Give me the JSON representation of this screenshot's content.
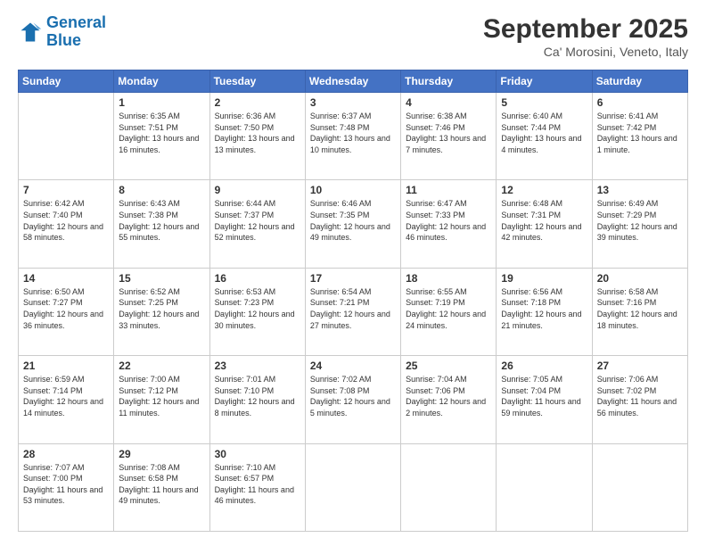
{
  "header": {
    "logo_line1": "General",
    "logo_line2": "Blue",
    "month": "September 2025",
    "location": "Ca' Morosini, Veneto, Italy"
  },
  "days_of_week": [
    "Sunday",
    "Monday",
    "Tuesday",
    "Wednesday",
    "Thursday",
    "Friday",
    "Saturday"
  ],
  "weeks": [
    [
      {
        "day": "",
        "sunrise": "",
        "sunset": "",
        "daylight": ""
      },
      {
        "day": "1",
        "sunrise": "Sunrise: 6:35 AM",
        "sunset": "Sunset: 7:51 PM",
        "daylight": "Daylight: 13 hours and 16 minutes."
      },
      {
        "day": "2",
        "sunrise": "Sunrise: 6:36 AM",
        "sunset": "Sunset: 7:50 PM",
        "daylight": "Daylight: 13 hours and 13 minutes."
      },
      {
        "day": "3",
        "sunrise": "Sunrise: 6:37 AM",
        "sunset": "Sunset: 7:48 PM",
        "daylight": "Daylight: 13 hours and 10 minutes."
      },
      {
        "day": "4",
        "sunrise": "Sunrise: 6:38 AM",
        "sunset": "Sunset: 7:46 PM",
        "daylight": "Daylight: 13 hours and 7 minutes."
      },
      {
        "day": "5",
        "sunrise": "Sunrise: 6:40 AM",
        "sunset": "Sunset: 7:44 PM",
        "daylight": "Daylight: 13 hours and 4 minutes."
      },
      {
        "day": "6",
        "sunrise": "Sunrise: 6:41 AM",
        "sunset": "Sunset: 7:42 PM",
        "daylight": "Daylight: 13 hours and 1 minute."
      }
    ],
    [
      {
        "day": "7",
        "sunrise": "Sunrise: 6:42 AM",
        "sunset": "Sunset: 7:40 PM",
        "daylight": "Daylight: 12 hours and 58 minutes."
      },
      {
        "day": "8",
        "sunrise": "Sunrise: 6:43 AM",
        "sunset": "Sunset: 7:38 PM",
        "daylight": "Daylight: 12 hours and 55 minutes."
      },
      {
        "day": "9",
        "sunrise": "Sunrise: 6:44 AM",
        "sunset": "Sunset: 7:37 PM",
        "daylight": "Daylight: 12 hours and 52 minutes."
      },
      {
        "day": "10",
        "sunrise": "Sunrise: 6:46 AM",
        "sunset": "Sunset: 7:35 PM",
        "daylight": "Daylight: 12 hours and 49 minutes."
      },
      {
        "day": "11",
        "sunrise": "Sunrise: 6:47 AM",
        "sunset": "Sunset: 7:33 PM",
        "daylight": "Daylight: 12 hours and 46 minutes."
      },
      {
        "day": "12",
        "sunrise": "Sunrise: 6:48 AM",
        "sunset": "Sunset: 7:31 PM",
        "daylight": "Daylight: 12 hours and 42 minutes."
      },
      {
        "day": "13",
        "sunrise": "Sunrise: 6:49 AM",
        "sunset": "Sunset: 7:29 PM",
        "daylight": "Daylight: 12 hours and 39 minutes."
      }
    ],
    [
      {
        "day": "14",
        "sunrise": "Sunrise: 6:50 AM",
        "sunset": "Sunset: 7:27 PM",
        "daylight": "Daylight: 12 hours and 36 minutes."
      },
      {
        "day": "15",
        "sunrise": "Sunrise: 6:52 AM",
        "sunset": "Sunset: 7:25 PM",
        "daylight": "Daylight: 12 hours and 33 minutes."
      },
      {
        "day": "16",
        "sunrise": "Sunrise: 6:53 AM",
        "sunset": "Sunset: 7:23 PM",
        "daylight": "Daylight: 12 hours and 30 minutes."
      },
      {
        "day": "17",
        "sunrise": "Sunrise: 6:54 AM",
        "sunset": "Sunset: 7:21 PM",
        "daylight": "Daylight: 12 hours and 27 minutes."
      },
      {
        "day": "18",
        "sunrise": "Sunrise: 6:55 AM",
        "sunset": "Sunset: 7:19 PM",
        "daylight": "Daylight: 12 hours and 24 minutes."
      },
      {
        "day": "19",
        "sunrise": "Sunrise: 6:56 AM",
        "sunset": "Sunset: 7:18 PM",
        "daylight": "Daylight: 12 hours and 21 minutes."
      },
      {
        "day": "20",
        "sunrise": "Sunrise: 6:58 AM",
        "sunset": "Sunset: 7:16 PM",
        "daylight": "Daylight: 12 hours and 18 minutes."
      }
    ],
    [
      {
        "day": "21",
        "sunrise": "Sunrise: 6:59 AM",
        "sunset": "Sunset: 7:14 PM",
        "daylight": "Daylight: 12 hours and 14 minutes."
      },
      {
        "day": "22",
        "sunrise": "Sunrise: 7:00 AM",
        "sunset": "Sunset: 7:12 PM",
        "daylight": "Daylight: 12 hours and 11 minutes."
      },
      {
        "day": "23",
        "sunrise": "Sunrise: 7:01 AM",
        "sunset": "Sunset: 7:10 PM",
        "daylight": "Daylight: 12 hours and 8 minutes."
      },
      {
        "day": "24",
        "sunrise": "Sunrise: 7:02 AM",
        "sunset": "Sunset: 7:08 PM",
        "daylight": "Daylight: 12 hours and 5 minutes."
      },
      {
        "day": "25",
        "sunrise": "Sunrise: 7:04 AM",
        "sunset": "Sunset: 7:06 PM",
        "daylight": "Daylight: 12 hours and 2 minutes."
      },
      {
        "day": "26",
        "sunrise": "Sunrise: 7:05 AM",
        "sunset": "Sunset: 7:04 PM",
        "daylight": "Daylight: 11 hours and 59 minutes."
      },
      {
        "day": "27",
        "sunrise": "Sunrise: 7:06 AM",
        "sunset": "Sunset: 7:02 PM",
        "daylight": "Daylight: 11 hours and 56 minutes."
      }
    ],
    [
      {
        "day": "28",
        "sunrise": "Sunrise: 7:07 AM",
        "sunset": "Sunset: 7:00 PM",
        "daylight": "Daylight: 11 hours and 53 minutes."
      },
      {
        "day": "29",
        "sunrise": "Sunrise: 7:08 AM",
        "sunset": "Sunset: 6:58 PM",
        "daylight": "Daylight: 11 hours and 49 minutes."
      },
      {
        "day": "30",
        "sunrise": "Sunrise: 7:10 AM",
        "sunset": "Sunset: 6:57 PM",
        "daylight": "Daylight: 11 hours and 46 minutes."
      },
      {
        "day": "",
        "sunrise": "",
        "sunset": "",
        "daylight": ""
      },
      {
        "day": "",
        "sunrise": "",
        "sunset": "",
        "daylight": ""
      },
      {
        "day": "",
        "sunrise": "",
        "sunset": "",
        "daylight": ""
      },
      {
        "day": "",
        "sunrise": "",
        "sunset": "",
        "daylight": ""
      }
    ]
  ]
}
